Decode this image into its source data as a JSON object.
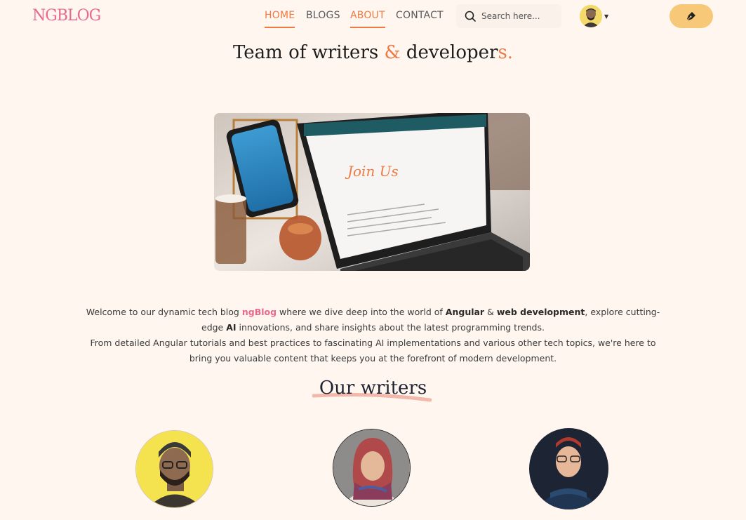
{
  "header": {
    "logo": "NGBLOG",
    "nav": [
      {
        "label": "HOME",
        "active": true
      },
      {
        "label": "BLOGS",
        "active": false
      },
      {
        "label": "ABOUT",
        "active": true
      },
      {
        "label": "CONTACT",
        "active": false
      }
    ],
    "search_placeholder": "Search here...",
    "write_icon": "pen-nib-icon"
  },
  "hero": {
    "title_part1": "Team of writers ",
    "title_amp": "&",
    "title_part2": " developer",
    "title_end": "s.",
    "image_caption": "Join Us"
  },
  "intro": {
    "p1_a": "Welcome to our dynamic tech blog ",
    "p1_brand": "ngBlog",
    "p1_b": " where we dive deep into the world of ",
    "p1_angular": "Angular",
    "p1_c": " & ",
    "p1_webdev": "web development",
    "p1_d": ", explore cutting-edge ",
    "p1_ai": "AI",
    "p1_e": " innovations, and share insights about the latest programming trends.",
    "p2": "From detailed Angular tutorials and best practices to fascinating AI implementations and various other tech topics, we're here to bring you valuable content that keeps you at the forefront of modern development."
  },
  "writers": {
    "heading": "Our writers"
  },
  "colors": {
    "accent": "#ee7a45",
    "brand": "#e8698c",
    "background": "#fff6ef",
    "write_button": "#f7c877"
  }
}
